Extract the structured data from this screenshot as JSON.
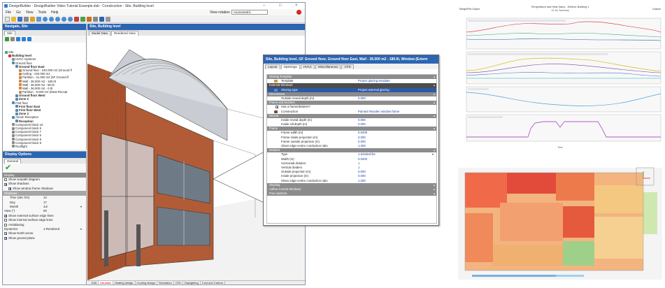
{
  "app": {
    "title": "DesignBuilder - DesignBuilder Video Tutorial Example.dsb - Construction - Site, Building level",
    "menus": [
      "File",
      "Go",
      "View",
      "Tools",
      "Help"
    ],
    "view_rotation_label": "View rotation",
    "view_rotation_value": "Axonometric"
  },
  "nav": {
    "title": "Navigate, Site",
    "tab": "Site",
    "tree": [
      {
        "t": "Site",
        "lvl": 0,
        "b": false,
        "c": "#3a7"
      },
      {
        "t": "Building level",
        "lvl": 1,
        "b": true,
        "c": "#c33"
      },
      {
        "t": "HVAC Systems",
        "lvl": 2,
        "b": false,
        "c": "#888"
      },
      {
        "t": "Ground floor",
        "lvl": 2,
        "b": false,
        "c": "#58a"
      },
      {
        "t": "Ground floor East",
        "lvl": 3,
        "b": true,
        "c": "#58a"
      },
      {
        "t": "Ground floor - 240.000 m2 (Ground fl",
        "lvl": 4,
        "b": false,
        "c": "#c84"
      },
      {
        "t": "Ceiling - 240.000 m2",
        "lvl": 4,
        "b": false,
        "c": "#c84"
      },
      {
        "t": "Partition - 11.000 m2 (6F Ground fl",
        "lvl": 4,
        "b": false,
        "c": "#c84"
      },
      {
        "t": "Wall - 36.000 m2 - 180.0t",
        "lvl": 4,
        "b": false,
        "c": "#c84"
      },
      {
        "t": "Wall - 36.000 m2 - 90.0t",
        "lvl": 4,
        "b": false,
        "c": "#c84"
      },
      {
        "t": "Wall - 36.000 m2 - 0.0t",
        "lvl": 4,
        "b": false,
        "c": "#c84"
      },
      {
        "t": "Partition - 9.000 m2 (Meat Recept",
        "lvl": 4,
        "b": false,
        "c": "#c84"
      },
      {
        "t": "Ground floor West",
        "lvl": 3,
        "b": true,
        "c": "#58a"
      },
      {
        "t": "Zone 2",
        "lvl": 3,
        "b": true,
        "c": "#58a"
      },
      {
        "t": "First floor",
        "lvl": 2,
        "b": false,
        "c": "#58a"
      },
      {
        "t": "First floor East",
        "lvl": 3,
        "b": true,
        "c": "#58a"
      },
      {
        "t": "First floor West",
        "lvl": 3,
        "b": true,
        "c": "#58a"
      },
      {
        "t": "Zone 2",
        "lvl": 3,
        "b": true,
        "c": "#58a"
      },
      {
        "t": "Atrium Reception",
        "lvl": 2,
        "b": false,
        "c": "#58a"
      },
      {
        "t": "Reception",
        "lvl": 3,
        "b": true,
        "c": "#58a"
      },
      {
        "t": "Component block 10",
        "lvl": 2,
        "b": false,
        "c": "#888"
      },
      {
        "t": "Component block 5",
        "lvl": 2,
        "b": false,
        "c": "#888"
      },
      {
        "t": "Component block 7",
        "lvl": 2,
        "b": false,
        "c": "#888"
      },
      {
        "t": "Component block 6",
        "lvl": 2,
        "b": false,
        "c": "#888"
      },
      {
        "t": "Component block 8",
        "lvl": 2,
        "b": false,
        "c": "#888"
      },
      {
        "t": "Component block 9",
        "lvl": 2,
        "b": false,
        "c": "#888"
      },
      {
        "t": "Rooflight",
        "lvl": 2,
        "b": false,
        "c": "#888"
      }
    ]
  },
  "display": {
    "title": "Display Options",
    "tab": "General",
    "group": "Display",
    "sub": "Shadows",
    "checks": [
      {
        "label": "Show sunpath diagram",
        "on": false
      },
      {
        "label": "Show shadows",
        "on": true
      },
      {
        "label": "Show window frame shadows",
        "on": true
      }
    ],
    "time_label": "Time (dec hrs)",
    "time_value": "12",
    "day_label": "Day",
    "day_value": "17",
    "month_label": "Month",
    "month_value": "Jul",
    "view_label": "View (°)",
    "view_value": "60",
    "checks2": [
      {
        "label": "Show external surface edge lines",
        "on": true
      },
      {
        "label": "Show internal surface edge lines",
        "on": false
      },
      {
        "label": "Antialiasing",
        "on": false
      }
    ],
    "dyn_label": "Dynamics",
    "dyn_value": "1-Rendered",
    "checks3": [
      {
        "label": "Show North arrow",
        "on": true
      },
      {
        "label": "Show ground plane",
        "on": true
      }
    ]
  },
  "main": {
    "title": "Site, Building level",
    "view_tabs": [
      "Model Data",
      "Rendered View"
    ],
    "bottom_tabs": [
      "Edit",
      "Visualise",
      "Heating design",
      "Cooling design",
      "Simulation",
      "CFD",
      "Daylighting",
      "Cost and Carbon"
    ]
  },
  "dialog": {
    "title": "Site, Building level, GF Ground floor, Ground floor East, Wall - 36.000 m2 - 180.0t, Window (Extern",
    "tabs": [
      "Layout",
      "Openings",
      "HVAC",
      "Miscellaneous",
      "CFD"
    ],
    "rows": [
      {
        "k": "h",
        "t": "Glazing Template"
      },
      {
        "k": "r",
        "t": "Template",
        "v": "Project glazing template",
        "ic": "#d39b2a"
      },
      {
        "k": "hd",
        "t": "External Windows"
      },
      {
        "k": "s",
        "t": "Glazing type",
        "v": "Project external glazing",
        "ic": "#5a8fd0"
      },
      {
        "k": "h",
        "t": "Dimensions"
      },
      {
        "k": "r",
        "t": "Outside reveal depth (m)",
        "v": "0.000"
      },
      {
        "k": "h",
        "t": "Frame and Dividers"
      },
      {
        "k": "c",
        "t": "Has a frame/dividers?"
      },
      {
        "k": "r",
        "t": "Construction",
        "v": "Painted Wooden window frame",
        "ic": "#7a4a2a"
      },
      {
        "k": "h",
        "t": "Reveal"
      },
      {
        "k": "r",
        "t": "Inside reveal depth (m)",
        "v": "0.000"
      },
      {
        "k": "r",
        "t": "Inside sill depth (m)",
        "v": "0.000"
      },
      {
        "k": "h",
        "t": "Frame"
      },
      {
        "k": "r",
        "t": "Frame width (m)",
        "v": "0.0400"
      },
      {
        "k": "r",
        "t": "Frame inside projection (m)",
        "v": "0.000"
      },
      {
        "k": "r",
        "t": "Frame outside projection (m)",
        "v": "0.000"
      },
      {
        "k": "r",
        "t": "Glass edge-centre conduction ratio",
        "v": "1.000"
      },
      {
        "k": "h",
        "t": "Dividers"
      },
      {
        "k": "d",
        "t": "Type",
        "v": "1-Divided lite"
      },
      {
        "k": "r",
        "t": "Width (m)",
        "v": "0.0200"
      },
      {
        "k": "r",
        "t": "Horizontal dividers",
        "v": "1"
      },
      {
        "k": "r",
        "t": "Vertical dividers",
        "v": "1"
      },
      {
        "k": "r",
        "t": "Outside projection (m)",
        "v": "0.000"
      },
      {
        "k": "r",
        "t": "Inside projection (m)",
        "v": "0.000"
      },
      {
        "k": "r",
        "t": "Glass edge-centre conduction ratio",
        "v": "1.000"
      },
      {
        "k": "h",
        "t": "Shading"
      },
      {
        "k": "h",
        "t": "Airflow Control Windows"
      },
      {
        "k": "h",
        "t": "Free Aperture"
      }
    ]
  },
  "results": {
    "left_label": "Range/Plot Output",
    "title": "Temperature and Heat Gains - EnMod, Building 1",
    "subtitle": "13 Jul, Summary",
    "right_label": "Custom",
    "xlabel": "Time"
  },
  "colors": {
    "accent": "#2c65b1",
    "header_grey": "#8c8c8c",
    "selected": "#2d5aa6"
  }
}
